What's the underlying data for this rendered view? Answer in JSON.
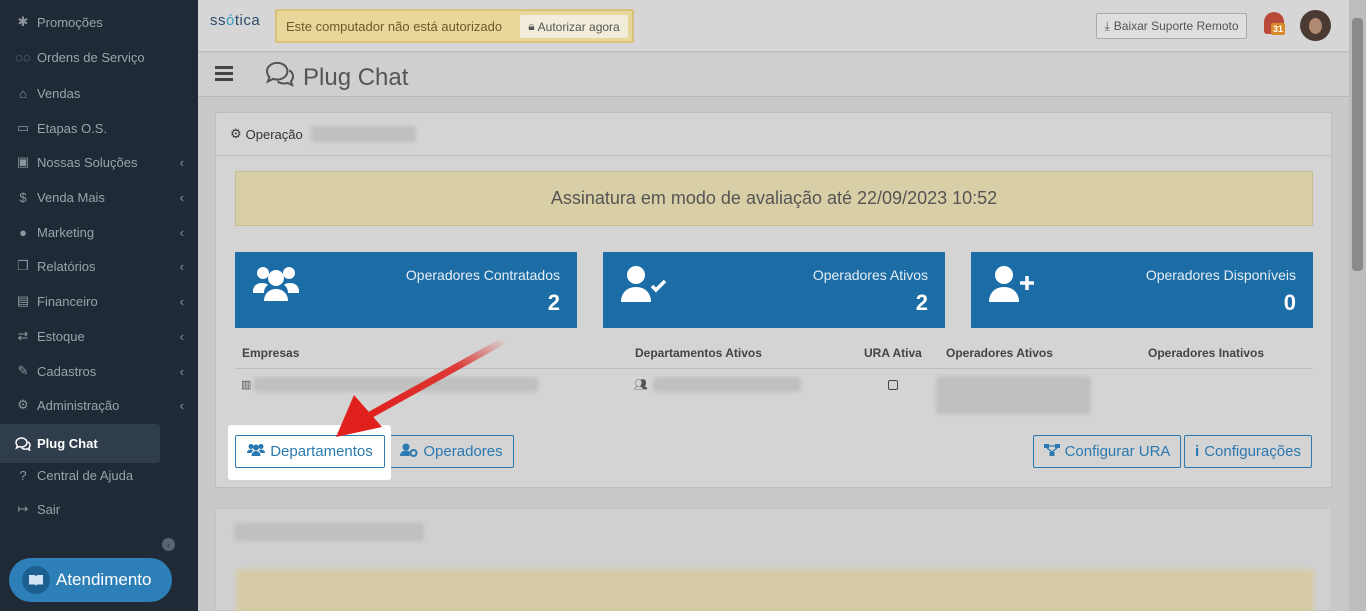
{
  "sidebar": {
    "items": [
      {
        "label": "Promoções",
        "icon": "asterisk-icon"
      },
      {
        "label": "Ordens de Serviço",
        "icon": "glasses-icon"
      },
      {
        "label": "Vendas",
        "icon": "basket-icon"
      },
      {
        "label": "Etapas O.S.",
        "icon": "card-icon"
      },
      {
        "label": "Nossas Soluções",
        "icon": "briefcase-icon"
      },
      {
        "label": "Venda Mais",
        "icon": "dollar-icon"
      },
      {
        "label": "Marketing",
        "icon": "comments-icon"
      },
      {
        "label": "Relatórios",
        "icon": "copy-icon"
      },
      {
        "label": "Financeiro",
        "icon": "money-icon"
      },
      {
        "label": "Estoque",
        "icon": "exchange-icon"
      },
      {
        "label": "Cadastros",
        "icon": "edit-icon"
      },
      {
        "label": "Administração",
        "icon": "cogs-icon"
      },
      {
        "label": "Plug Chat",
        "icon": "chat-icon"
      },
      {
        "label": "Central de Ajuda",
        "icon": "question-icon"
      },
      {
        "label": "Sair",
        "icon": "sign-out-icon"
      }
    ],
    "atendimento_label": "Atendimento"
  },
  "topbar": {
    "logo_prefix": "ss",
    "logo_o": "ó",
    "logo_suffix": "tica",
    "warning_text": "Este computador não está autorizado",
    "authorize_label": "Autorizar agora",
    "remote_label": "Baixar Suporte Remoto",
    "notification_count": "31"
  },
  "page": {
    "title": "Plug Chat"
  },
  "card": {
    "header": "Operação",
    "alert": "Assinatura em modo de avaliação até 22/09/2023 10:52",
    "stats": [
      {
        "label": "Operadores Contratados",
        "value": "2"
      },
      {
        "label": "Operadores Ativos",
        "value": "2"
      },
      {
        "label": "Operadores Disponíveis",
        "value": "0"
      }
    ],
    "table_headers": [
      "Empresas",
      "Departamentos Ativos",
      "URA Ativa",
      "Operadores Ativos",
      "Operadores Inativos"
    ],
    "buttons": {
      "departamentos": "Departamentos",
      "operadores": "Operadores",
      "configurar_ura": "Configurar URA",
      "configuracoes": "Configurações"
    }
  },
  "colors": {
    "sidebar_bg": "#1f2a36",
    "stat_blue": "#1c6da6",
    "accent": "#2a79b0",
    "arrow_red": "#e0201c"
  }
}
